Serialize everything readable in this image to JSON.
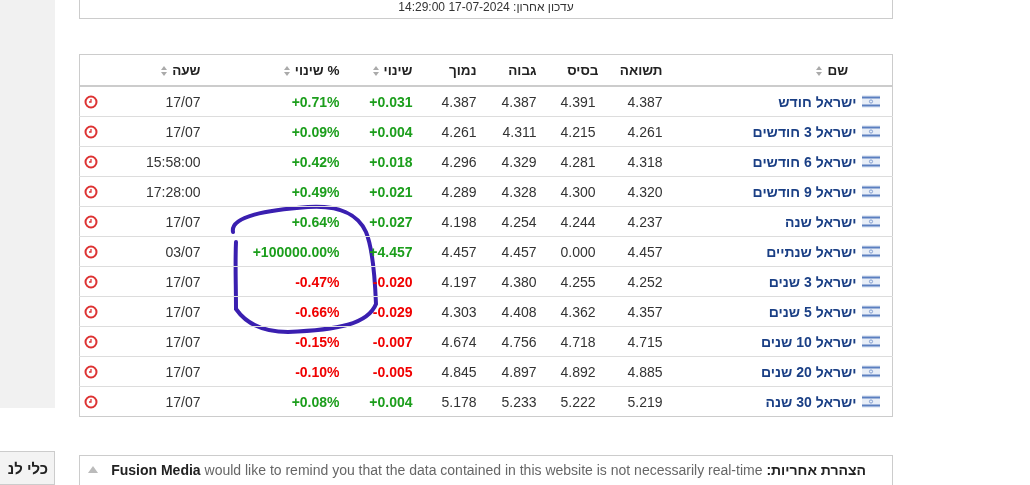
{
  "update_note": "עדכון אחרון: 17-07-2024 14:29:00",
  "table": {
    "columns": [
      {
        "label": "שם",
        "sortable": true
      },
      {
        "label": "תשואה",
        "sortable": false
      },
      {
        "label": "בסיס",
        "sortable": false
      },
      {
        "label": "גבוה",
        "sortable": false
      },
      {
        "label": "נמוך",
        "sortable": false
      },
      {
        "label": "שינוי",
        "sortable": true
      },
      {
        "label": "% שינוי",
        "sortable": true
      },
      {
        "label": "שעה",
        "sortable": true
      }
    ],
    "rows": [
      {
        "name": "ישראל חודש",
        "yield": "4.387",
        "base": "4.391",
        "high": "4.387",
        "low": "4.387",
        "change": "+0.031",
        "change_pct": "+0.71%",
        "time": "17/07",
        "rising": true
      },
      {
        "name": "ישראל 3 חודשים",
        "yield": "4.261",
        "base": "4.215",
        "high": "4.311",
        "low": "4.261",
        "change": "+0.004",
        "change_pct": "+0.09%",
        "time": "17/07",
        "rising": true
      },
      {
        "name": "ישראל 6 חודשים",
        "yield": "4.318",
        "base": "4.281",
        "high": "4.329",
        "low": "4.296",
        "change": "+0.018",
        "change_pct": "+0.42%",
        "time": "15:58:00",
        "rising": true
      },
      {
        "name": "ישראל 9 חודשים",
        "yield": "4.320",
        "base": "4.300",
        "high": "4.328",
        "low": "4.289",
        "change": "+0.021",
        "change_pct": "+0.49%",
        "time": "17:28:00",
        "rising": true
      },
      {
        "name": "ישראל שנה",
        "yield": "4.237",
        "base": "4.244",
        "high": "4.254",
        "low": "4.198",
        "change": "+0.027",
        "change_pct": "+0.64%",
        "time": "17/07",
        "rising": true
      },
      {
        "name": "ישראל שנתיים",
        "yield": "4.457",
        "base": "0.000",
        "high": "4.457",
        "low": "4.457",
        "change": "+4.457",
        "change_pct": "+100000.00%",
        "time": "03/07",
        "rising": true
      },
      {
        "name": "ישראל 3 שנים",
        "yield": "4.252",
        "base": "4.255",
        "high": "4.380",
        "low": "4.197",
        "change": "-0.020",
        "change_pct": "-0.47%",
        "time": "17/07",
        "rising": false
      },
      {
        "name": "ישראל 5 שנים",
        "yield": "4.357",
        "base": "4.362",
        "high": "4.408",
        "low": "4.303",
        "change": "-0.029",
        "change_pct": "-0.66%",
        "time": "17/07",
        "rising": false
      },
      {
        "name": "ישראל 10 שנים",
        "yield": "4.715",
        "base": "4.718",
        "high": "4.756",
        "low": "4.674",
        "change": "-0.007",
        "change_pct": "-0.15%",
        "time": "17/07",
        "rising": false
      },
      {
        "name": "ישראל 20 שנים",
        "yield": "4.885",
        "base": "4.892",
        "high": "4.897",
        "low": "4.845",
        "change": "-0.005",
        "change_pct": "-0.10%",
        "time": "17/07",
        "rising": false
      },
      {
        "name": "ישראל 30 שנה",
        "yield": "5.219",
        "base": "5.222",
        "high": "5.233",
        "low": "5.178",
        "change": "+0.004",
        "change_pct": "+0.08%",
        "time": "17/07",
        "rising": true
      }
    ]
  },
  "side_button": "כלי לנ",
  "disclaimer": "**הצהרת אחריות:** **Fusion Media** would like to remind you that the data contained in this website is not necessarily real-time"
}
